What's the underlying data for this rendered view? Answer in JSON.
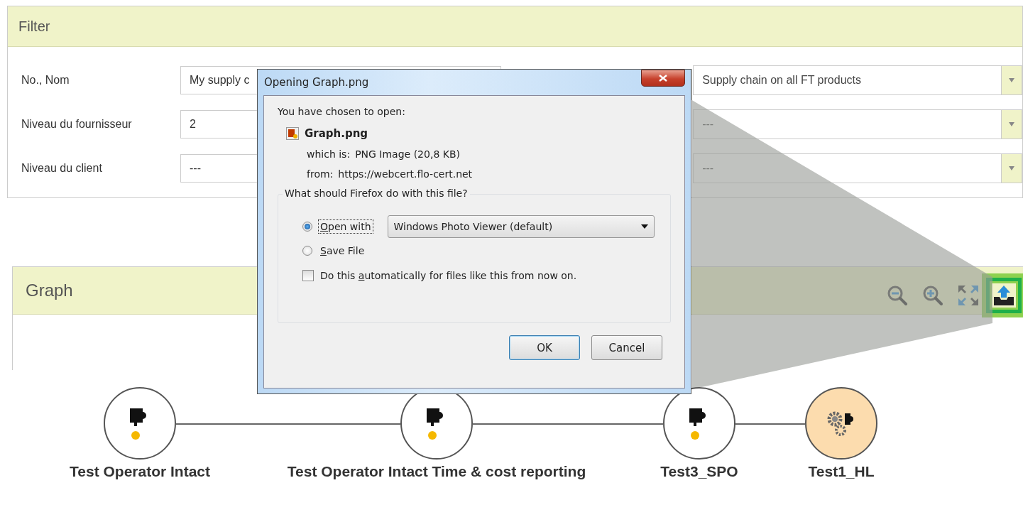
{
  "filter": {
    "title": "Filter",
    "fields": [
      {
        "label": "No., Nom",
        "value": "My supply c"
      },
      {
        "label": "Niveau du fournisseur",
        "value": "2"
      },
      {
        "label": "Niveau du client",
        "value": "---"
      }
    ],
    "dropdowns": [
      {
        "value": "Supply chain on all FT products"
      },
      {
        "value": "---"
      },
      {
        "value": "---"
      }
    ]
  },
  "graph": {
    "title": "Graph",
    "toolbar": [
      {
        "kind": "zoom-out",
        "highlighted": false
      },
      {
        "kind": "zoom-in",
        "highlighted": false
      },
      {
        "kind": "fullscreen",
        "highlighted": false
      },
      {
        "kind": "export",
        "highlighted": true
      }
    ],
    "nodes": [
      {
        "label": "Test Operator Intact",
        "kind": "puzzle"
      },
      {
        "label": "Test Operator Intact Time & cost reporting",
        "kind": "puzzle"
      },
      {
        "label": "Test3_SPO",
        "kind": "puzzle"
      },
      {
        "label": "Test1_HL",
        "kind": "gears"
      }
    ]
  },
  "dialog": {
    "title": "Opening Graph.png",
    "intro": "You have chosen to open:",
    "file_name": "Graph.png",
    "details": [
      {
        "label": "which is:",
        "value": "PNG Image (20,8 KB)"
      },
      {
        "label": "from:",
        "value": "https://webcert.flo-cert.net"
      }
    ],
    "question": "What should Firefox do with this file?",
    "options": [
      {
        "label_parts": [
          {
            "text": "O",
            "underlined": true
          },
          {
            "text": "pen with",
            "underlined": false
          }
        ],
        "selected": true,
        "focused": true
      },
      {
        "label_parts": [
          {
            "text": "S",
            "underlined": true
          },
          {
            "text": "ave File",
            "underlined": false
          }
        ],
        "selected": false,
        "focused": false
      }
    ],
    "app": "Windows Photo Viewer (default)",
    "checkbox": {
      "label_parts": [
        {
          "text": "Do this ",
          "underlined": false
        },
        {
          "text": "a",
          "underlined": true
        },
        {
          "text": "utomatically for files like this from now on.",
          "underlined": false
        }
      ],
      "checked": false
    },
    "buttons": [
      {
        "label": "OK",
        "default": true
      },
      {
        "label": "Cancel",
        "default": false
      }
    ]
  }
}
